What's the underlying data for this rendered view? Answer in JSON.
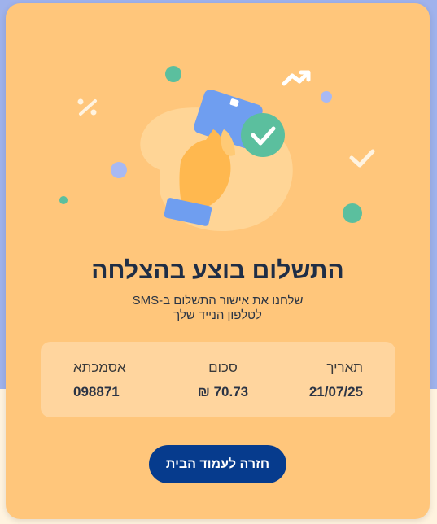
{
  "success": {
    "title": "התשלום בוצע בהצלחה",
    "subtitle_line1": "שלחנו את אישור התשלום ב-SMS",
    "subtitle_line2": "לטלפון הנייד שלך"
  },
  "details": {
    "date_label": "תאריך",
    "date_value": "21/07/25",
    "amount_label": "סכום",
    "amount_value": "70.73 ₪",
    "reference_label": "אסמכתא",
    "reference_value": "098871"
  },
  "actions": {
    "home_button": "חזרה לעמוד הבית"
  },
  "colors": {
    "card_background": "#ffc67b",
    "button_background": "#063b8d",
    "check_badge": "#5bbf9e",
    "payment_card": "#6f9ef0"
  },
  "icons": [
    "hand-holding-card-icon",
    "check-circle-icon",
    "percent-icon",
    "trending-up-arrow-icon",
    "checkmark-icon"
  ]
}
